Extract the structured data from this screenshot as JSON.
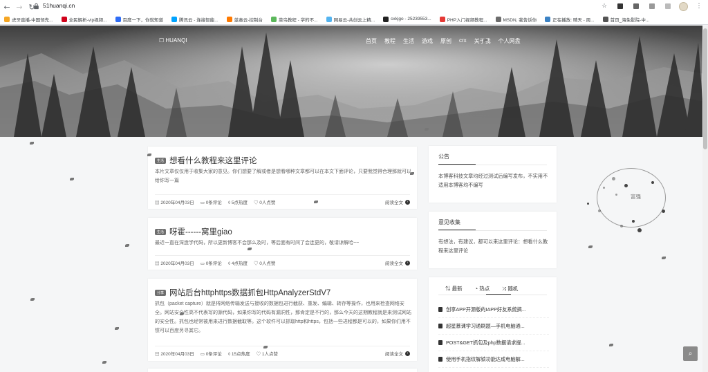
{
  "browser": {
    "url": "51huanqi.cn",
    "bookmarks": [
      {
        "label": "虎牙直播-中国领先...",
        "color": "#f5a623"
      },
      {
        "label": "全民解析-vip视频...",
        "color": "#d0021b"
      },
      {
        "label": "百度一下，你就知道",
        "color": "#2f6df6"
      },
      {
        "label": "腾讯云 - 连接智能...",
        "color": "#00a3ff"
      },
      {
        "label": "蓝奏云-控制台",
        "color": "#ff7a00"
      },
      {
        "label": "菜鸟教程 - 学的不...",
        "color": "#5cb85c"
      },
      {
        "label": "网易云-共创云上精...",
        "color": "#54b4f0"
      },
      {
        "label": "cxkjgo - 25239553...",
        "color": "#222222"
      },
      {
        "label": "PHP入门视频教程...",
        "color": "#e53935"
      },
      {
        "label": "MSDN, 我告诉你",
        "color": "#6c6c6c"
      },
      {
        "label": "正在播放: 晴天 - 周...",
        "color": "#3b82c4"
      },
      {
        "label": "首页_海免影院-中...",
        "color": "#555555"
      }
    ]
  },
  "site": {
    "logo": "HUANQI",
    "nav": [
      "首页",
      "教程",
      "生活",
      "游戏",
      "原创",
      "crx",
      "关于我",
      "个人网盘"
    ]
  },
  "posts": [
    {
      "tag": "生活",
      "title": "想看什么教程来这里评论",
      "excerpt": "本片文章仅仅用于收集大家的意见。你们想要了解或者是想看哪种文章都可以在本文下面评论，只要我觉得合理那就可以给你写一篇",
      "date": "2020年04月03日",
      "comments": "0条评论",
      "heat": "5点热度",
      "likes": "0人点赞",
      "read_more": "阅读全文"
    },
    {
      "tag": "生活",
      "title": "呀霍------窝里giao",
      "excerpt": "最近一直在深造学代码，所以更新博客不会那么及时，等后面有时间了会连更的，敬请谅解哈~~",
      "date": "2020年04月03日",
      "comments": "0条评论",
      "heat": "4点热度",
      "likes": "0人点赞",
      "read_more": "阅读全文"
    },
    {
      "tag": "分享",
      "title": "网站后台httphttps数据抓包HttpAnalyzerStdV7",
      "excerpt": "抓包（packet capture）就是将网络传输发送与接收的数据包进行截获、重发、编辑、转存等操作，也用来检查网络安全。网站安全性高不代表写的源代码，如果你写的代码有漏洞性，那肯定是不行的，那么今天的这期教程就是来测试网站的安全性。抓包也经常被用来进行数据截取等。这个软件可以抓取http和https，包括一些进程都是可以的，如果你们用不惯可以百度另寻其它。",
      "date": "2020年04月03日",
      "comments": "0条评论",
      "heat": "15点热度",
      "likes": "1人点赞",
      "read_more": "阅读全文"
    }
  ],
  "sidebar": {
    "notice": {
      "heading": "公告",
      "text": "本博客科技文章均经过测试后编写发布，不实用不适用本博客均不编写"
    },
    "feedback": {
      "heading": "意见收集",
      "text": "有想法，有建议，都可以来这里评论：想看什么教程来这里评论"
    },
    "tabs": [
      "最新",
      "热点",
      "随机"
    ],
    "hot": [
      "创享APP开源版的IAPP好友系统搞...",
      "超星慕课学习通刷题—手机电脑通...",
      "POST&GET抓包及php数据请求提...",
      "使用手机指纹解锁功能达成电脑解..."
    ]
  },
  "circle_label": "富强"
}
